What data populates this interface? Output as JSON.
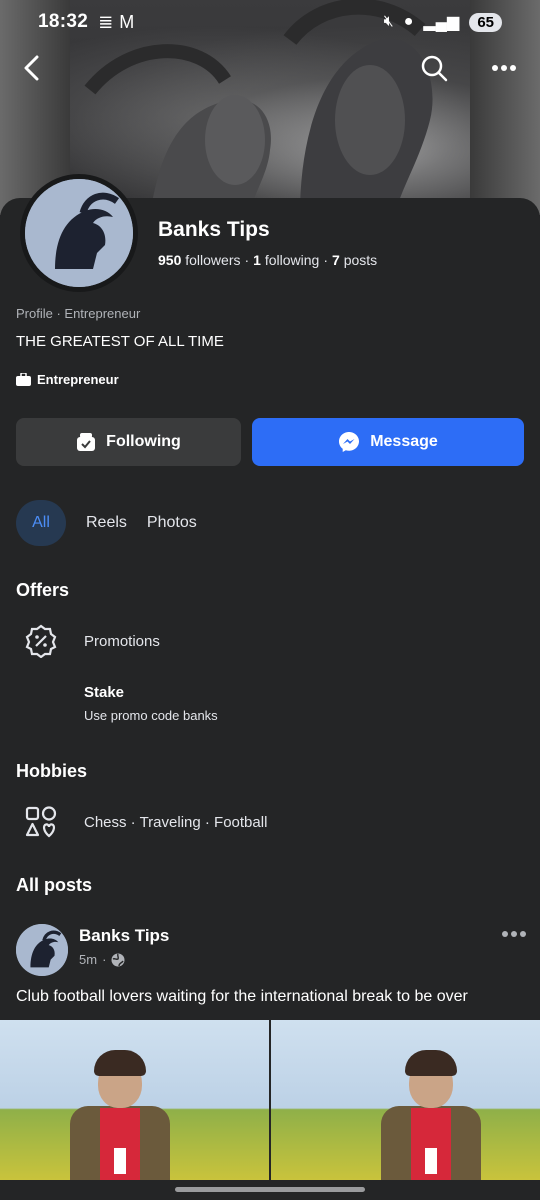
{
  "status_bar": {
    "time": "18:32",
    "battery": "65"
  },
  "profile": {
    "name": "Banks Tips",
    "followers_count": "950",
    "followers_label": "followers",
    "following_count": "1",
    "following_label": "following",
    "posts_count": "7",
    "posts_label": "posts",
    "category_line": "Profile · Entrepreneur",
    "bio": "THE GREATEST OF ALL TIME",
    "tag": "Entrepreneur"
  },
  "actions": {
    "following_label": "Following",
    "message_label": "Message"
  },
  "tabs": [
    {
      "label": "All",
      "active": true
    },
    {
      "label": "Reels",
      "active": false
    },
    {
      "label": "Photos",
      "active": false
    }
  ],
  "offers": {
    "title": "Offers",
    "promotions_label": "Promotions",
    "offer_title": "Stake",
    "offer_subtitle": "Use promo code banks"
  },
  "hobbies": {
    "title": "Hobbies",
    "items": "Chess · Traveling · Football"
  },
  "all_posts": {
    "title": "All posts",
    "post": {
      "author": "Banks Tips",
      "time": "5m",
      "text": "Club football lovers waiting for the international break to be over"
    }
  },
  "colors": {
    "background": "#242526",
    "message_button": "#2d6df6",
    "following_button": "#3a3b3c",
    "active_tab_bg": "#263951",
    "active_tab_text": "#4c8ef7"
  }
}
